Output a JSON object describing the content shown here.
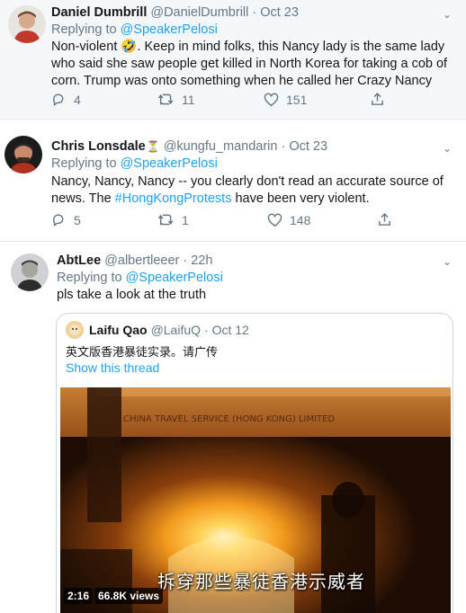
{
  "tweets": [
    {
      "name": "Daniel Dumbrill",
      "handle": "@DanielDumbrill",
      "date": "· Oct 23",
      "replying_prefix": "Replying to ",
      "replying_to": "@SpeakerPelosi",
      "text_line1": "Non-violent 🤣. Keep in mind folks, this Nancy lady is the same  lady",
      "text_line2": "who said she saw people get killed in North Korea for taking a cob of",
      "text_line3": "corn. Trump was onto something when he called her Crazy Nancy",
      "replies": "4",
      "retweets": "11",
      "likes": "151"
    },
    {
      "name": "Chris Lonsdale",
      "name_emoji": "⏳",
      "handle": "@kungfu_mandarin",
      "date": "· Oct 23",
      "replying_prefix": "Replying to ",
      "replying_to": "@SpeakerPelosi",
      "text_line1": "Nancy, Nancy, Nancy -- you clearly don't read an accurate source of",
      "text_line2_pre": "news.  The ",
      "text_line2_hashtag": "#HongKongProtests",
      "text_line2_post": " have been very violent.",
      "replies": "5",
      "retweets": "1",
      "likes": "148"
    },
    {
      "name": "AbtLee",
      "handle": "@albertleeer",
      "date": "· 22h",
      "replying_prefix": "Replying to ",
      "replying_to": "@SpeakerPelosi",
      "text": "pls take a look at the truth",
      "quote": {
        "name": "Laifu Qao",
        "handle": "@LaifuQ",
        "date": "· Oct 12",
        "text": "英文版香港暴徒实录。请广传",
        "show_thread": "Show this thread",
        "video": {
          "duration": "2:16",
          "views": "66.8K views",
          "subtitle": "拆穿那些暴徒香港示威者",
          "sign_text": "CHINA TRAVEL SERVICE (HONG KONG) LIMITED"
        }
      }
    }
  ],
  "colors": {
    "accent": "#1da1f2",
    "muted": "#657786",
    "text": "#14171a",
    "highlight_bg": "#f5f8fa"
  }
}
